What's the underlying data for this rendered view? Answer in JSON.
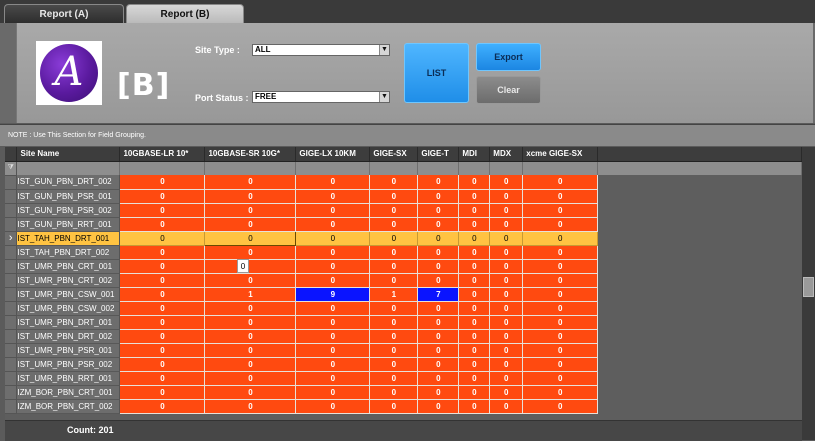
{
  "tabs": [
    {
      "label": "Report (A)"
    },
    {
      "label": "Report (B)"
    }
  ],
  "header": {
    "variant_label": "[B]",
    "site_type": {
      "label": "Site Type :",
      "value": "ALL"
    },
    "port_status": {
      "label": "Port Status :",
      "value": "FREE"
    },
    "buttons": {
      "list": "LIST",
      "export": "Export",
      "clear": "Clear"
    }
  },
  "note": "NOTE : Use This Section for Field Grouping.",
  "grid": {
    "columns": [
      "Site Name",
      "10GBASE-LR 10*",
      "10GBASE-SR 10G*",
      "GIGE-LX 10KM",
      "GIGE-SX",
      "GIGE-T",
      "MDI",
      "MDX",
      "xcme GIGE-SX"
    ],
    "rows": [
      {
        "site": "IST_GUN_PBN_DRT_002",
        "values": [
          "0",
          "0",
          "0",
          "0",
          "0",
          "0",
          "0",
          "0"
        ]
      },
      {
        "site": "IST_GUN_PBN_PSR_001",
        "values": [
          "0",
          "0",
          "0",
          "0",
          "0",
          "0",
          "0",
          "0"
        ]
      },
      {
        "site": "IST_GUN_PBN_PSR_002",
        "values": [
          "0",
          "0",
          "0",
          "0",
          "0",
          "0",
          "0",
          "0"
        ]
      },
      {
        "site": "IST_GUN_PBN_RRT_001",
        "values": [
          "0",
          "0",
          "0",
          "0",
          "0",
          "0",
          "0",
          "0"
        ]
      },
      {
        "site": "IST_TAH_PBN_DRT_001",
        "values": [
          "0",
          "0",
          "0",
          "0",
          "0",
          "0",
          "0",
          "0"
        ],
        "selected": true
      },
      {
        "site": "IST_TAH_PBN_DRT_002",
        "values": [
          "0",
          "0",
          "0",
          "0",
          "0",
          "0",
          "0",
          "0"
        ]
      },
      {
        "site": "IST_UMR_PBN_CRT_001",
        "values": [
          "0",
          "",
          "0",
          "0",
          "0",
          "0",
          "0",
          "0"
        ]
      },
      {
        "site": "IST_UMR_PBN_CRT_002",
        "values": [
          "0",
          "0",
          "0",
          "0",
          "0",
          "0",
          "0",
          "0"
        ]
      },
      {
        "site": "IST_UMR_PBN_CSW_001",
        "values": [
          "0",
          "1",
          "9",
          "1",
          "7",
          "0",
          "0",
          "0"
        ],
        "highlight": [
          2,
          4
        ]
      },
      {
        "site": "IST_UMR_PBN_CSW_002",
        "values": [
          "0",
          "0",
          "0",
          "0",
          "0",
          "0",
          "0",
          "0"
        ]
      },
      {
        "site": "IST_UMR_PBN_DRT_001",
        "values": [
          "0",
          "0",
          "0",
          "0",
          "0",
          "0",
          "0",
          "0"
        ]
      },
      {
        "site": "IST_UMR_PBN_DRT_002",
        "values": [
          "0",
          "0",
          "0",
          "0",
          "0",
          "0",
          "0",
          "0"
        ]
      },
      {
        "site": "IST_UMR_PBN_PSR_001",
        "values": [
          "0",
          "0",
          "0",
          "0",
          "0",
          "0",
          "0",
          "0"
        ]
      },
      {
        "site": "IST_UMR_PBN_PSR_002",
        "values": [
          "0",
          "0",
          "0",
          "0",
          "0",
          "0",
          "0",
          "0"
        ]
      },
      {
        "site": "IST_UMR_PBN_RRT_001",
        "values": [
          "0",
          "0",
          "0",
          "0",
          "0",
          "0",
          "0",
          "0"
        ]
      },
      {
        "site": "IZM_BOR_PBN_CRT_001",
        "values": [
          "0",
          "0",
          "0",
          "0",
          "0",
          "0",
          "0",
          "0"
        ]
      },
      {
        "site": "IZM_BOR_PBN_CRT_002",
        "values": [
          "0",
          "0",
          "0",
          "0",
          "0",
          "0",
          "0",
          "0"
        ]
      }
    ],
    "tooltip": "0",
    "filter_icon": "filter-icon",
    "row_indicator": "selected-row-arrow-icon"
  },
  "footer": {
    "count_label": "Count: 201"
  },
  "colors": {
    "cell": "#ff4a10",
    "selected": "#ffc342",
    "highlight": "#0a14ff",
    "button": "#2a9ff2"
  }
}
